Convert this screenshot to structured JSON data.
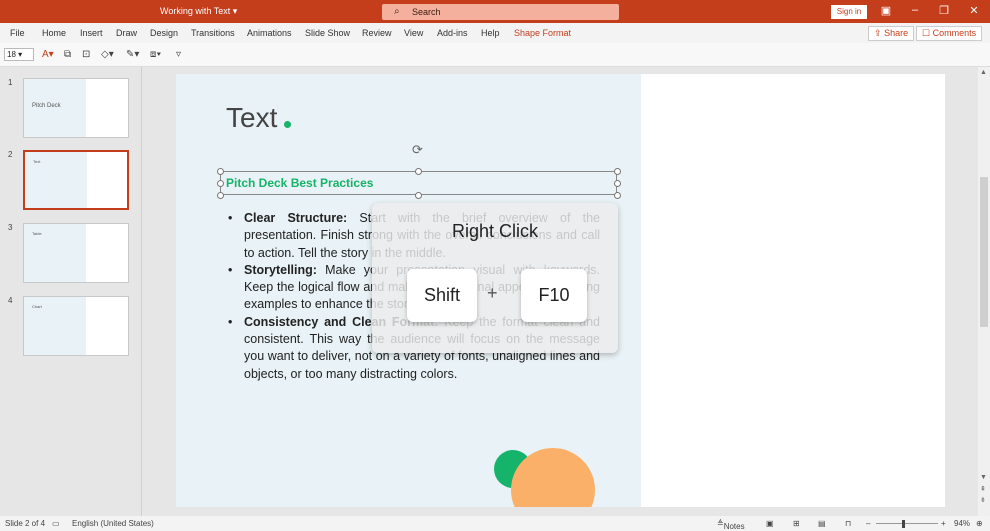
{
  "titlebar": {
    "doc_title": "Working with Text",
    "search_placeholder": "Search",
    "signin_label": "Sign in"
  },
  "menu": {
    "tabs": [
      "File",
      "Home",
      "Insert",
      "Draw",
      "Design",
      "Transitions",
      "Animations",
      "Slide Show",
      "Review",
      "View",
      "Add-ins",
      "Help",
      "Shape Format"
    ],
    "share_label": "Share",
    "comments_label": "Comments"
  },
  "ribbon": {
    "font_size": "18"
  },
  "thumbnails": [
    {
      "number": "1",
      "label": "Pitch Deck"
    },
    {
      "number": "2",
      "label": "Text"
    },
    {
      "number": "3",
      "label": "Table"
    },
    {
      "number": "4",
      "label": "Chart"
    }
  ],
  "slide": {
    "title": "Text",
    "heading": "Pitch Deck Best Practices",
    "bullets": [
      {
        "term": "Clear Structure:",
        "text": " Start with the brief overview of the presentation. Finish strong with the overall conclusions and call to action. Tell the story in the middle."
      },
      {
        "term": "Storytelling:",
        "text": " Make your presentation visual with keywords. Keep the logical flow and make an emotional appeal with strong examples to enhance the story."
      },
      {
        "term": "Consistency and Clean Format:",
        "text": " Keep the format clean and consistent. This way the audience will focus on the message you want to deliver, not on a variety of fonts, unaligned lines and objects, or too many distracting colors."
      }
    ]
  },
  "shortcut": {
    "caption": "Right Click",
    "key1": "Shift",
    "plus": "+",
    "key2": "F10"
  },
  "status": {
    "slide_info": "Slide 2 of 4",
    "language": "English (United States)",
    "notes_label": "Notes",
    "zoom": "94%"
  },
  "colors": {
    "accent": "#c43e1c",
    "green": "#16b36a",
    "orange": "#fbb06a"
  }
}
